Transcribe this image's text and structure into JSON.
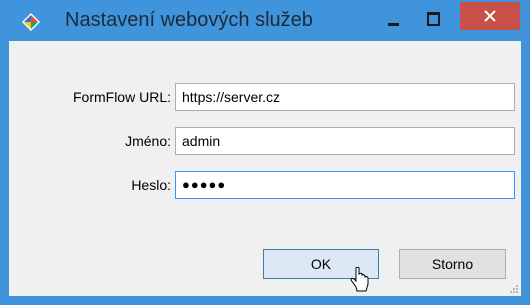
{
  "window": {
    "title": "Nastavení webových služeb",
    "icon": "app-icon",
    "controls": [
      "minimize-icon",
      "maximize-icon",
      "close-icon"
    ]
  },
  "form": {
    "url_label": "FormFlow URL:",
    "url_value": "https://server.cz",
    "name_label": "Jméno:",
    "name_value": "admin",
    "password_label": "Heslo:",
    "password_value": "●●●●●"
  },
  "buttons": {
    "ok_label": "OK",
    "cancel_label": "Storno"
  },
  "colors": {
    "titlebar": "#3f94dc",
    "close": "#c7504b",
    "client": "#f0f0f0"
  }
}
